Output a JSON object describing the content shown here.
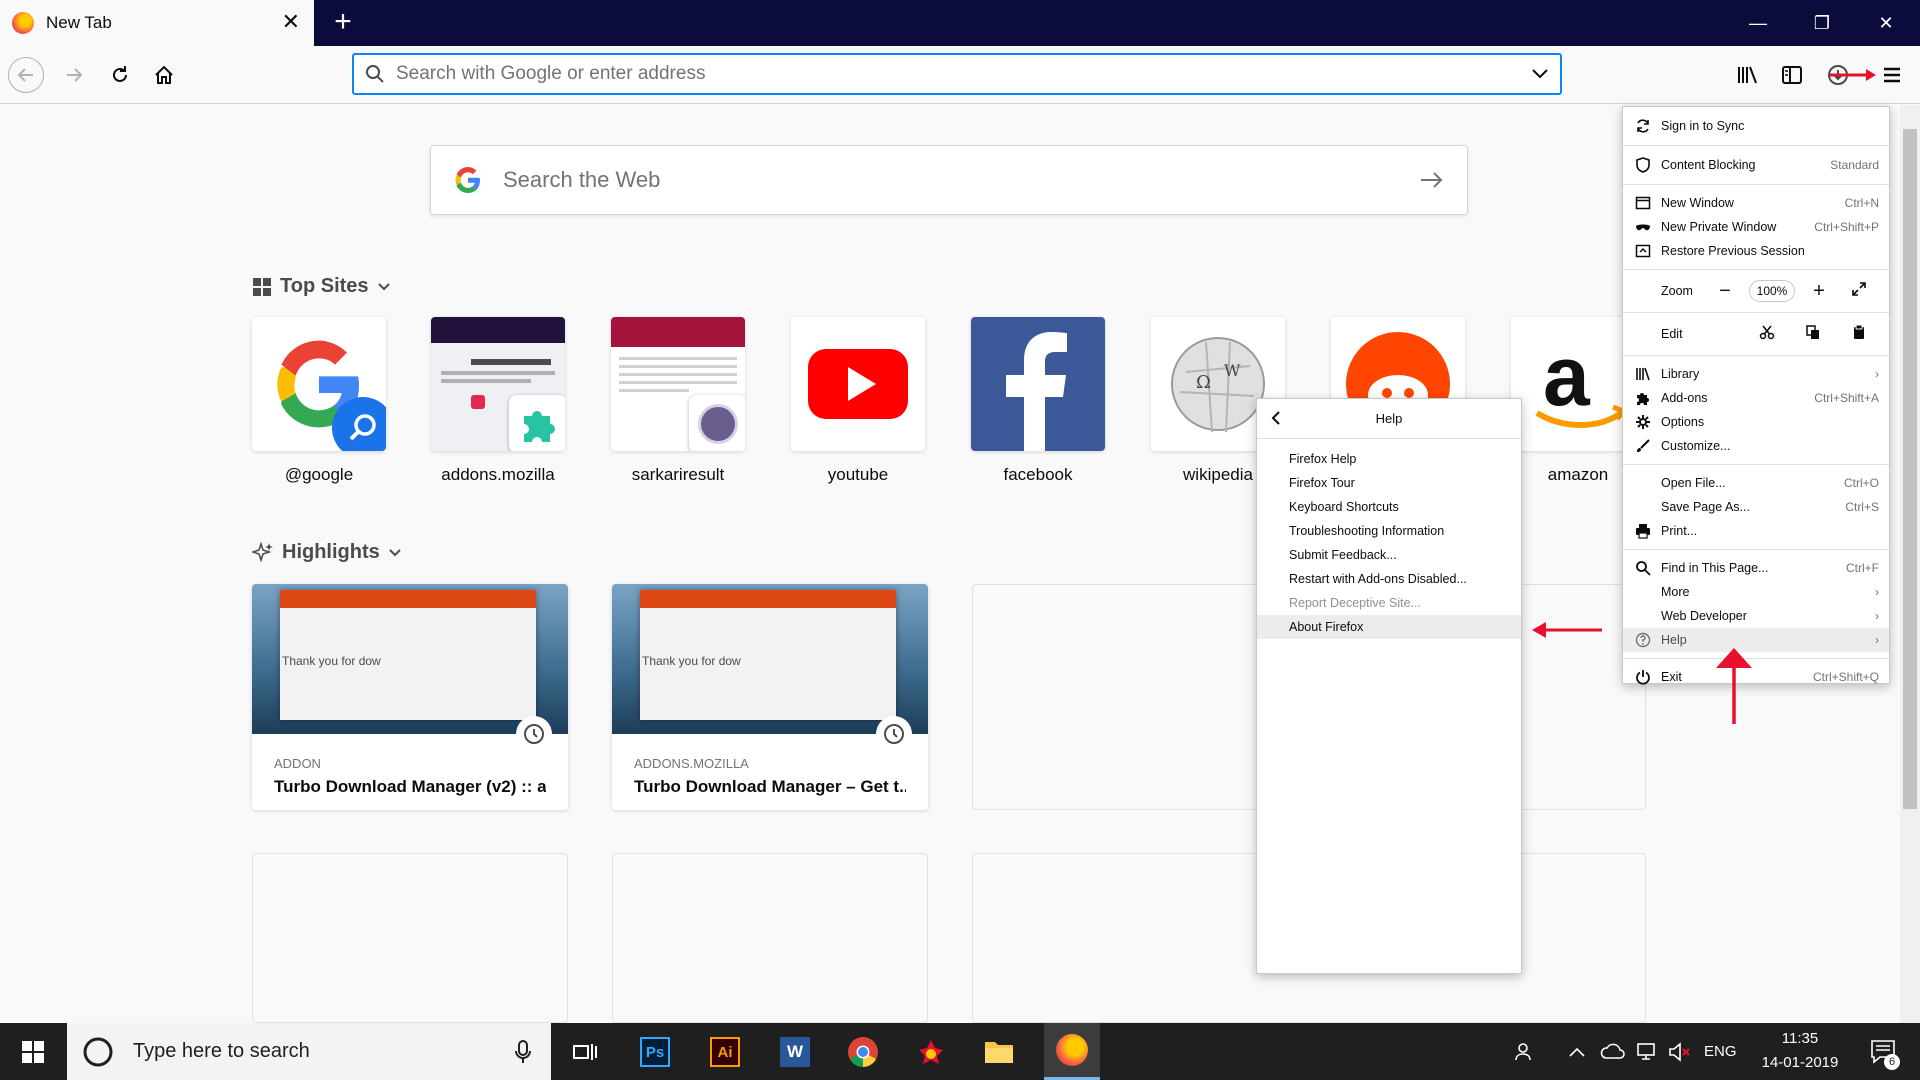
{
  "browser": {
    "tab_title": "New Tab",
    "tab_close": "✕",
    "new_tab": "+",
    "window_controls": [
      "—",
      "❐",
      "✕"
    ],
    "url_placeholder": "Search with Google or enter address"
  },
  "newtab": {
    "search_placeholder": "Search the Web",
    "top_sites_label": "Top Sites",
    "highlights_label": "Highlights",
    "top_sites": [
      {
        "name": "@google",
        "icon": "google-icon"
      },
      {
        "name": "addons.mozilla",
        "icon": "addons-thumbnail"
      },
      {
        "name": "sarkariresult",
        "icon": "sarkariresult-thumbnail"
      },
      {
        "name": "youtube",
        "icon": "youtube-icon"
      },
      {
        "name": "facebook",
        "icon": "facebook-icon"
      },
      {
        "name": "wikipedia",
        "icon": "wikipedia-icon"
      },
      {
        "name": "reddit",
        "icon": "reddit-icon"
      },
      {
        "name": "amazon",
        "icon": "amazon-icon"
      }
    ],
    "highlights": [
      {
        "source": "ADDON",
        "title": "Turbo Download Manager (v2) :: a...",
        "snippet": "Thank you for dow"
      },
      {
        "source": "ADDONS.MOZILLA",
        "title": "Turbo Download Manager – Get t...",
        "snippet": "Thank you for dow"
      }
    ]
  },
  "help_menu": {
    "title": "Help",
    "items": [
      {
        "label": "Firefox Help",
        "disabled": false
      },
      {
        "label": "Firefox Tour",
        "disabled": false
      },
      {
        "label": "Keyboard Shortcuts",
        "disabled": false
      },
      {
        "label": "Troubleshooting Information",
        "disabled": false
      },
      {
        "label": "Submit Feedback...",
        "disabled": false
      },
      {
        "label": "Restart with Add-ons Disabled...",
        "disabled": false
      },
      {
        "label": "Report Deceptive Site...",
        "disabled": true
      },
      {
        "label": "About Firefox",
        "disabled": false,
        "selected": true
      }
    ]
  },
  "app_menu": {
    "sign_in": "Sign in to Sync",
    "content_blocking": "Content Blocking",
    "content_blocking_value": "Standard",
    "new_window": "New Window",
    "new_window_sc": "Ctrl+N",
    "new_private": "New Private Window",
    "new_private_sc": "Ctrl+Shift+P",
    "restore": "Restore Previous Session",
    "zoom": "Zoom",
    "zoom_out": "−",
    "zoom_value": "100%",
    "zoom_in": "+",
    "edit": "Edit",
    "library": "Library",
    "addons": "Add-ons",
    "addons_sc": "Ctrl+Shift+A",
    "options": "Options",
    "customize": "Customize...",
    "open_file": "Open File...",
    "open_file_sc": "Ctrl+O",
    "save_page": "Save Page As...",
    "save_page_sc": "Ctrl+S",
    "print": "Print...",
    "find": "Find in This Page...",
    "find_sc": "Ctrl+F",
    "more": "More",
    "web_dev": "Web Developer",
    "help": "Help",
    "exit": "Exit",
    "exit_sc": "Ctrl+Shift+Q"
  },
  "taskbar": {
    "search_placeholder": "Type here to search",
    "apps": [
      "Ps",
      "Ai",
      "W"
    ],
    "lang": "ENG",
    "time": "11:35",
    "date": "14-01-2019",
    "notifications": "6"
  },
  "colors": {
    "tab_bar": "#0c0c3c",
    "accent": "#0a84ff",
    "annotation_red": "#e8102c"
  }
}
